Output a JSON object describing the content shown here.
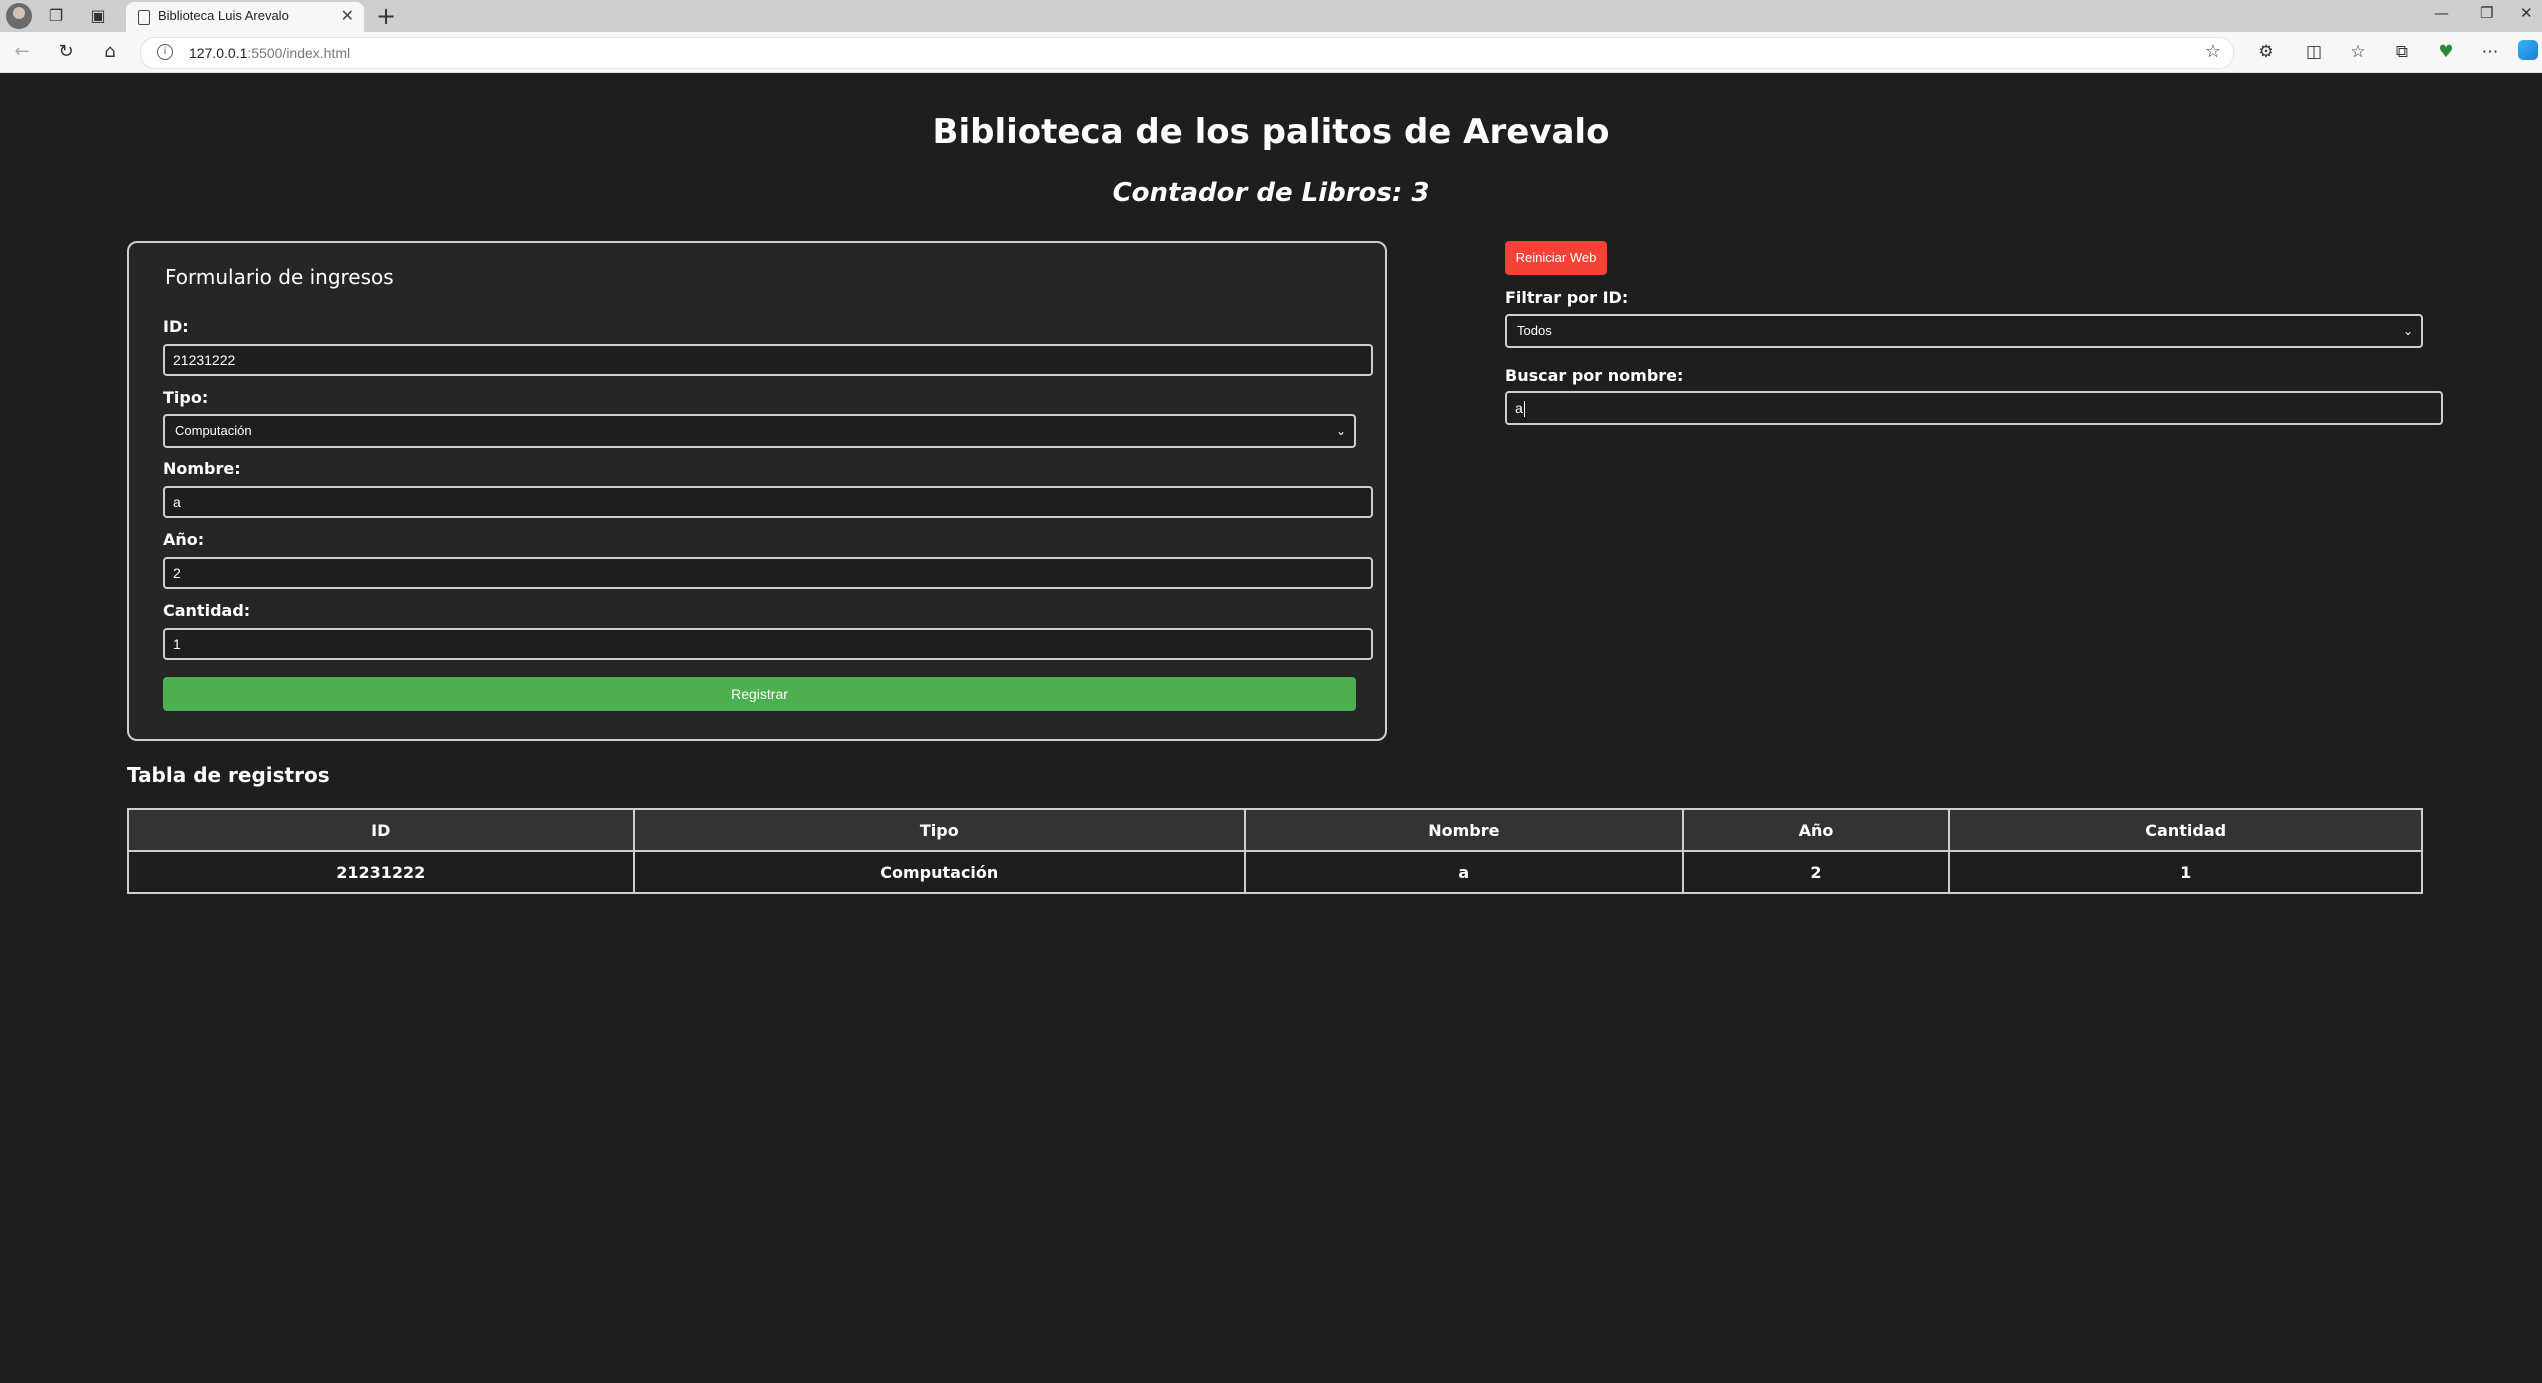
{
  "browser": {
    "tab_title": "Biblioteca Luis Arevalo",
    "url_host": "127.0.0.1",
    "url_rest": ":5500/index.html"
  },
  "header": {
    "title": "Biblioteca de los palitos de Arevalo",
    "counter": "Contador de Libros: 3"
  },
  "form": {
    "legend": "Formulario de ingresos",
    "id_label": "ID:",
    "id_value": "21231222",
    "tipo_label": "Tipo:",
    "tipo_value": "Computación",
    "nombre_label": "Nombre:",
    "nombre_value": "a",
    "anio_label": "Año:",
    "anio_value": "2",
    "cantidad_label": "Cantidad:",
    "cantidad_value": "1",
    "submit_label": "Registrar"
  },
  "controls": {
    "reset_label": "Reiniciar Web",
    "filter_label": "Filtrar por ID:",
    "filter_value": "Todos",
    "search_label": "Buscar por nombre:",
    "search_value": "a"
  },
  "table": {
    "title": "Tabla de registros",
    "headers": [
      "ID",
      "Tipo",
      "Nombre",
      "Año",
      "Cantidad"
    ],
    "rows": [
      [
        "21231222",
        "Computación",
        "a",
        "2",
        "1"
      ]
    ]
  },
  "colors": {
    "background": "#1e1e1e",
    "register_button": "#4caf50",
    "reset_button": "#f44336"
  }
}
